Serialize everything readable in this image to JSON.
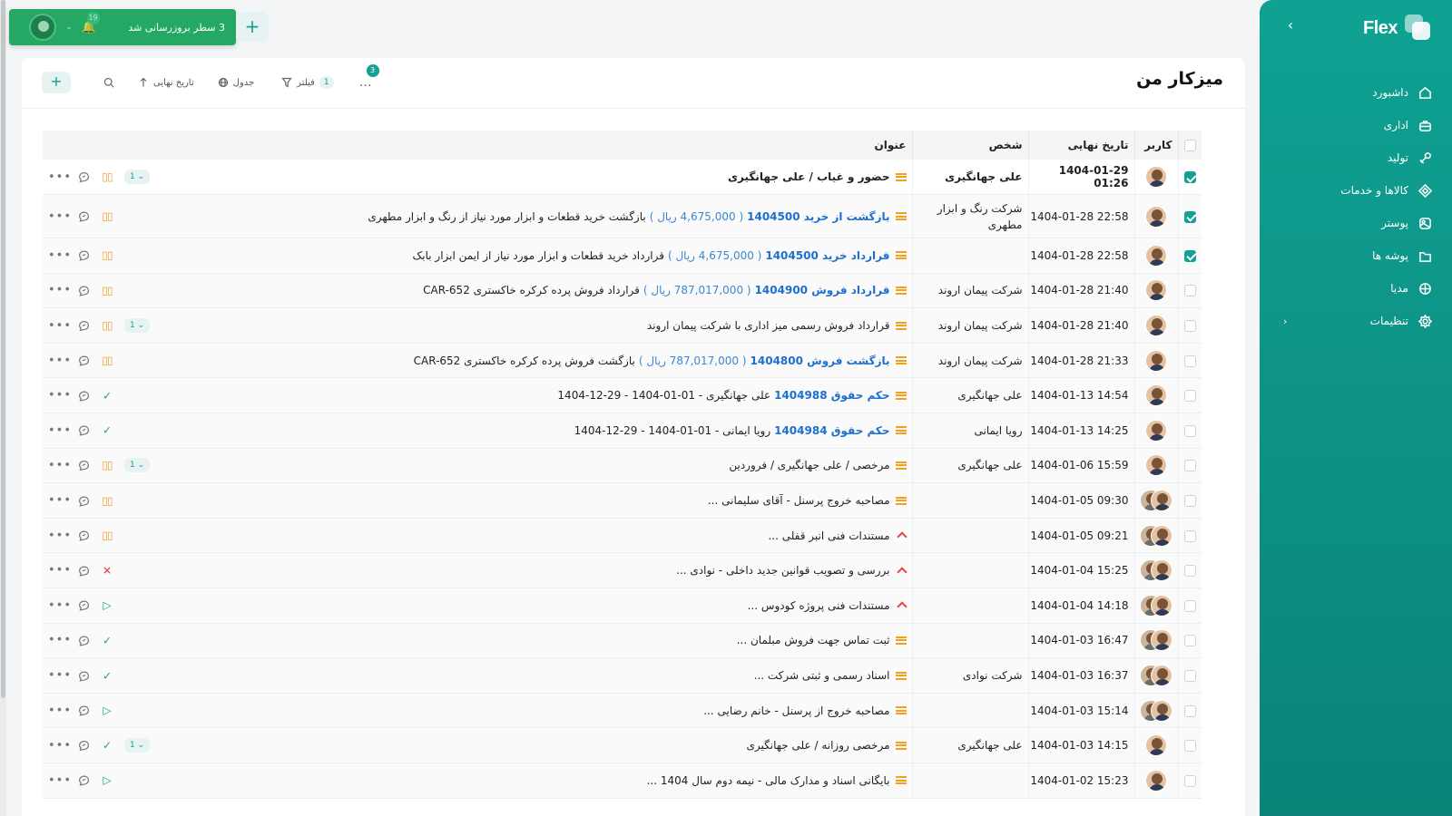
{
  "brand": {
    "name": "Flex"
  },
  "toast": {
    "message": "3 سطر بروزرسانی شد",
    "notifications": "19"
  },
  "sidebar": {
    "items": [
      {
        "label": "داشبورد",
        "icon": "home-icon"
      },
      {
        "label": "اداری",
        "icon": "briefcase-icon"
      },
      {
        "label": "تولید",
        "icon": "tool-icon"
      },
      {
        "label": "کالاها و خدمات",
        "icon": "cube-icon"
      },
      {
        "label": "پوستر",
        "icon": "poster-icon"
      },
      {
        "label": "پوشه ها",
        "icon": "folder-icon"
      },
      {
        "label": "مدیا",
        "icon": "media-icon"
      },
      {
        "label": "تنظیمات",
        "icon": "gear-icon",
        "expandable": true
      }
    ]
  },
  "page": {
    "title": "میزکار من"
  },
  "toolbar": {
    "more_count": "3",
    "filter_label": "فیلتر",
    "filter_count": "1",
    "table_label": "جدول",
    "sort_label": "تاریخ نهایی"
  },
  "table": {
    "headers": {
      "user": "کاربر",
      "date": "تاریخ نهایی",
      "person": "شخص",
      "title": "عنوان"
    },
    "rows": [
      {
        "checked": true,
        "avatars": 1,
        "date": "1404-01-29 01:26",
        "person": "علی جهانگیری",
        "bold": true,
        "priority": "med",
        "link": "",
        "amount": "",
        "text": "حضور و غیاب / علی جهانگیری",
        "status": "pause",
        "sub": "1"
      },
      {
        "checked": true,
        "avatars": 1,
        "date": "1404-01-28 22:58",
        "person": "شرکت رنگ و ابزار مطهری",
        "bold": false,
        "priority": "med",
        "link": "بازگشت از خرید 1404500",
        "amount": "( 4,675,000 ریال )",
        "text": "بازگشت خرید قطعات و ابزار مورد نیاز از رنگ و ابزار مطهری",
        "status": "pause",
        "sub": ""
      },
      {
        "checked": true,
        "avatars": 1,
        "date": "1404-01-28 22:58",
        "person": "",
        "bold": false,
        "priority": "med",
        "link": "قرارداد خرید 1404500",
        "amount": "( 4,675,000 ریال )",
        "text": "قرارداد خرید قطعات و ابزار مورد نیاز از ایمن ابزار بابک",
        "status": "pause",
        "sub": ""
      },
      {
        "checked": false,
        "avatars": 1,
        "date": "1404-01-28 21:40",
        "person": "شرکت پیمان اروند",
        "bold": false,
        "priority": "med",
        "link": "قرارداد فروش 1404900",
        "amount": "( 787,017,000 ریال )",
        "text": "قرارداد فروش پرده کرکره خاکستری CAR-652",
        "status": "pause",
        "sub": ""
      },
      {
        "checked": false,
        "avatars": 1,
        "date": "1404-01-28 21:40",
        "person": "شرکت پیمان اروند",
        "bold": false,
        "priority": "med",
        "link": "",
        "amount": "",
        "text": "قرارداد فروش رسمی میز اداری با شرکت پیمان اروند",
        "status": "pause",
        "sub": "1"
      },
      {
        "checked": false,
        "avatars": 1,
        "date": "1404-01-28 21:33",
        "person": "شرکت پیمان اروند",
        "bold": false,
        "priority": "med",
        "link": "بازگشت فروش 1404800",
        "amount": "( 787,017,000 ریال )",
        "text": "بازگشت فروش پرده کرکره خاکستری CAR-652",
        "status": "pause",
        "sub": ""
      },
      {
        "checked": false,
        "avatars": 1,
        "date": "1404-01-13 14:54",
        "person": "علی جهانگیری",
        "bold": false,
        "priority": "med",
        "link": "حکم حقوق 1404988",
        "amount": "",
        "text": "علی جهانگیری - 01-01-1404 - 29-12-1404",
        "status": "done",
        "sub": ""
      },
      {
        "checked": false,
        "avatars": 1,
        "date": "1404-01-13 14:25",
        "person": "رویا ایمانی",
        "bold": false,
        "priority": "med",
        "link": "حکم حقوق 1404984",
        "amount": "",
        "text": "رویا ایمانی - 01-01-1404 - 29-12-1404",
        "status": "done",
        "sub": ""
      },
      {
        "checked": false,
        "avatars": 1,
        "date": "1404-01-06 15:59",
        "person": "علی جهانگیری",
        "bold": false,
        "priority": "med",
        "link": "",
        "amount": "",
        "text": "مرخصی / علی جهانگیری / فروردین",
        "status": "pause",
        "sub": "1"
      },
      {
        "checked": false,
        "avatars": 2,
        "date": "1404-01-05 09:30",
        "person": "",
        "bold": false,
        "priority": "med",
        "link": "",
        "amount": "",
        "text": "مصاحبه خروج پرسنل - آقای سلیمانی ...",
        "status": "pause",
        "sub": ""
      },
      {
        "checked": false,
        "avatars": 2,
        "date": "1404-01-05 09:21",
        "person": "",
        "bold": false,
        "priority": "high",
        "link": "",
        "amount": "",
        "text": "مستندات فنی انبر قفلی ...",
        "status": "pause",
        "sub": ""
      },
      {
        "checked": false,
        "avatars": 2,
        "date": "1404-01-04 15:25",
        "person": "",
        "bold": false,
        "priority": "high",
        "link": "",
        "amount": "",
        "text": "بررسی و تصویب قوانین جدید داخلی - نوادی ...",
        "status": "cancel",
        "sub": ""
      },
      {
        "checked": false,
        "avatars": 2,
        "date": "1404-01-04 14:18",
        "person": "",
        "bold": false,
        "priority": "high",
        "link": "",
        "amount": "",
        "text": "مستندات فنی پروژه کودوس ...",
        "status": "play",
        "sub": ""
      },
      {
        "checked": false,
        "avatars": 2,
        "date": "1404-01-03 16:47",
        "person": "",
        "bold": false,
        "priority": "med",
        "link": "",
        "amount": "",
        "text": "ثبت تماس جهت فروش مبلمان ...",
        "status": "done",
        "sub": ""
      },
      {
        "checked": false,
        "avatars": 2,
        "date": "1404-01-03 16:37",
        "person": "شرکت نوادی",
        "bold": false,
        "priority": "med",
        "link": "",
        "amount": "",
        "text": "اسناد رسمی و ثبتی شرکت ...",
        "status": "done",
        "sub": ""
      },
      {
        "checked": false,
        "avatars": 2,
        "date": "1404-01-03 15:14",
        "person": "",
        "bold": false,
        "priority": "med",
        "link": "",
        "amount": "",
        "text": "مصاحبه خروج از پرسنل - خانم رضایی ...",
        "status": "play",
        "sub": ""
      },
      {
        "checked": false,
        "avatars": 1,
        "date": "1404-01-03 14:15",
        "person": "علی جهانگیری",
        "bold": false,
        "priority": "med",
        "link": "",
        "amount": "",
        "text": "مرخصی روزانه / علی جهانگیری",
        "status": "done",
        "sub": "1"
      },
      {
        "checked": false,
        "avatars": 1,
        "date": "1404-01-02 15:23",
        "person": "",
        "bold": false,
        "priority": "med",
        "link": "",
        "amount": "",
        "text": "بایگانی اسناد و مدارک مالی - نیمه دوم سال 1404 ...",
        "status": "play",
        "sub": ""
      }
    ]
  }
}
